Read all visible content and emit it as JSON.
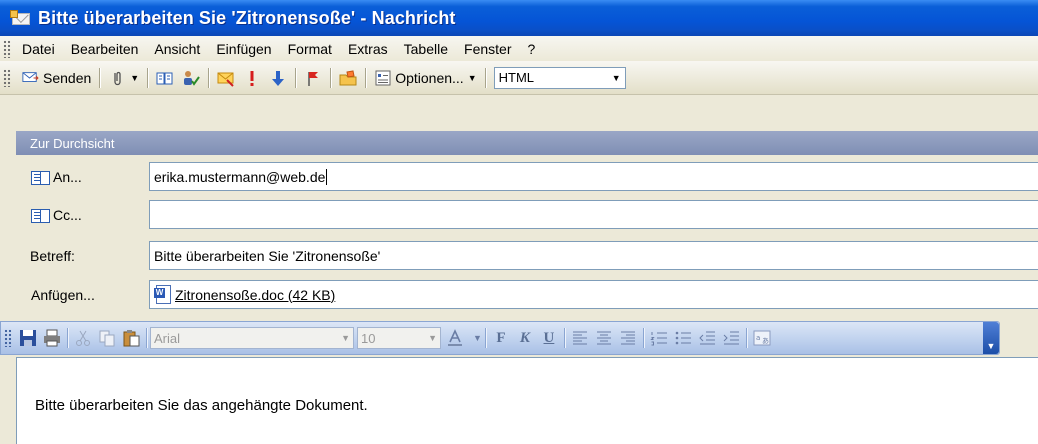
{
  "window": {
    "title": "Bitte überarbeiten Sie 'Zitronensoße' - Nachricht"
  },
  "menu": {
    "items": [
      {
        "label": "Datei"
      },
      {
        "label": "Bearbeiten"
      },
      {
        "label": "Ansicht"
      },
      {
        "label": "Einfügen"
      },
      {
        "label": "Format"
      },
      {
        "label": "Extras"
      },
      {
        "label": "Tabelle"
      },
      {
        "label": "Fenster"
      },
      {
        "label": "?"
      }
    ]
  },
  "toolbar": {
    "send_label": "Senden",
    "options_label": "Optionen...",
    "format_value": "HTML"
  },
  "infobar": {
    "text": "Zur Durchsicht"
  },
  "fields": {
    "to_label": "An...",
    "to_value": "erika.mustermann@web.de",
    "cc_label": "Cc...",
    "cc_value": "",
    "subject_label": "Betreff:",
    "subject_value": "Bitte überarbeiten Sie 'Zitronensoße'",
    "attach_label": "Anfügen...",
    "attachment": "Zitronensoße.doc (42 KB)"
  },
  "format_bar": {
    "font": "Arial",
    "size": "10"
  },
  "body": {
    "text": "Bitte überarbeiten Sie das angehängte Dokument."
  },
  "colors": {
    "title_blue": "#0554d6",
    "infobar": "#8b98bd"
  }
}
